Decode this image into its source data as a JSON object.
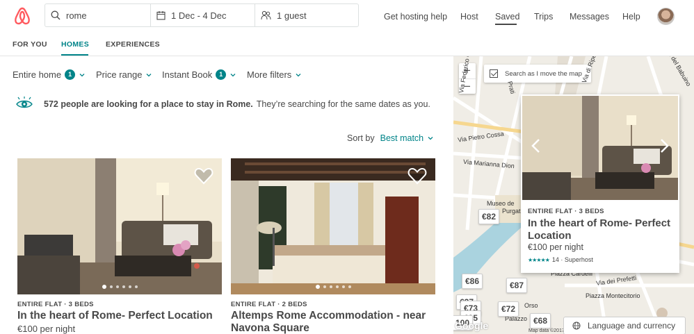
{
  "colors": {
    "brand": "#FF5A5F",
    "accent": "#008489",
    "text": "#484848"
  },
  "search": {
    "location": "rome",
    "dates": "1 Dec - 4 Dec",
    "guests": "1 guest",
    "icons": [
      "search-icon",
      "calendar-icon",
      "guests-icon"
    ]
  },
  "nav": {
    "hosting_help": "Get hosting help",
    "host": "Host",
    "saved": "Saved",
    "trips": "Trips",
    "messages": "Messages",
    "help": "Help"
  },
  "tabs": [
    {
      "label": "FOR YOU",
      "active": false
    },
    {
      "label": "HOMES",
      "active": true
    },
    {
      "label": "EXPERIENCES",
      "active": false
    }
  ],
  "filters": {
    "entire_home": {
      "label": "Entire home",
      "count": "1"
    },
    "price_range": {
      "label": "Price range"
    },
    "instant_book": {
      "label": "Instant Book",
      "count": "1"
    },
    "more_filters": {
      "label": "More filters"
    }
  },
  "notice": {
    "bold": "572 people are looking for a place to stay in Rome.",
    "sub": "They’re searching for the same dates as you."
  },
  "sort": {
    "label": "Sort by",
    "value": "Best match"
  },
  "listings": [
    {
      "meta": "ENTIRE FLAT · 3 BEDS",
      "title": "In the heart of Rome- Perfect Location",
      "price": "€100 per night",
      "dots": 6,
      "active_dot": 1
    },
    {
      "meta": "ENTIRE FLAT · 2 BEDS",
      "title": "Altemps Rome Accommodation - near Navona Square",
      "price": "",
      "dots": 6,
      "active_dot": 1
    }
  ],
  "map": {
    "zoom_in": "+",
    "zoom_out": "−",
    "search_as_move": "Search as I move the map",
    "streets": [
      "Via Federico Cesi",
      "Via Pietro Cossa",
      "Via Marianna Dion",
      "Museo de",
      "Purgat",
      "Prati",
      "Via di Ripetta",
      "Via del Babuino",
      "Piazza Cardelli",
      "Via dei Prefetti",
      "Piazza Montecitorio",
      "Palazzo",
      "Orso"
    ],
    "prices": [
      "€82",
      "€86",
      "€87",
      "€73",
      "€72",
      "€68",
      "€27",
      "€95",
      "100"
    ],
    "popup": {
      "meta": "ENTIRE FLAT · 3 BEDS",
      "title": "In the heart of Rome- Perfect Location",
      "price": "€100 per night",
      "stars": "★★★★★",
      "rating": "14 · Superhost"
    },
    "language": "Language and currency",
    "google": "Google",
    "attribution": "Map data ©2017"
  }
}
